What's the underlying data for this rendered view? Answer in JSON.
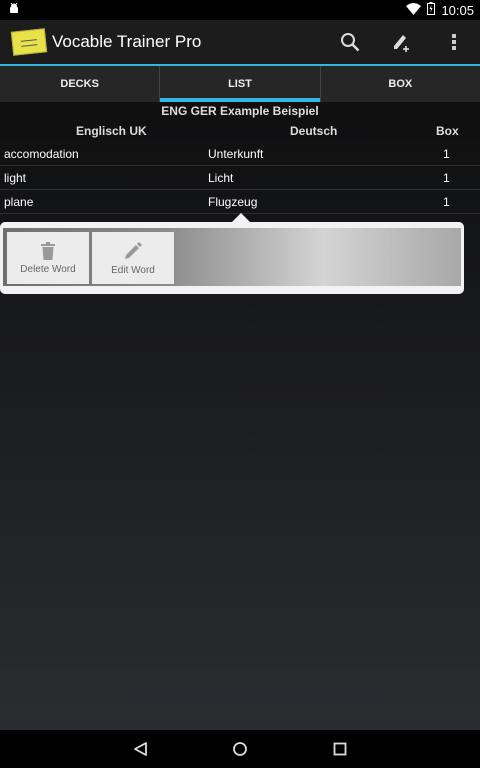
{
  "status_bar": {
    "time": "10:05"
  },
  "action_bar": {
    "title": "Vocable Trainer Pro"
  },
  "tabs": [
    {
      "label": "DECKS"
    },
    {
      "label": "LIST",
      "active": true
    },
    {
      "label": "BOX"
    }
  ],
  "deck": {
    "title": "ENG GER Example Beispiel"
  },
  "table": {
    "headers": [
      "Englisch UK",
      "Deutsch",
      "Box"
    ],
    "rows": [
      {
        "term": "accomodation",
        "translation": "Unterkunft",
        "box": "1"
      },
      {
        "term": "light",
        "translation": "Licht",
        "box": "1"
      },
      {
        "term": "plane",
        "translation": "Flugzeug",
        "box": "1"
      }
    ]
  },
  "popup": {
    "delete_label": "Delete Word",
    "edit_label": "Edit Word"
  },
  "colors": {
    "accent": "#33b5e5",
    "popup_bg": "#f2f2f2"
  },
  "icons": [
    "android-icon",
    "wifi-icon",
    "battery-icon",
    "app-icon",
    "search-icon",
    "add-word-icon",
    "overflow-menu-icon",
    "trash-icon",
    "pencil-icon",
    "back-icon",
    "home-icon",
    "recents-icon"
  ]
}
